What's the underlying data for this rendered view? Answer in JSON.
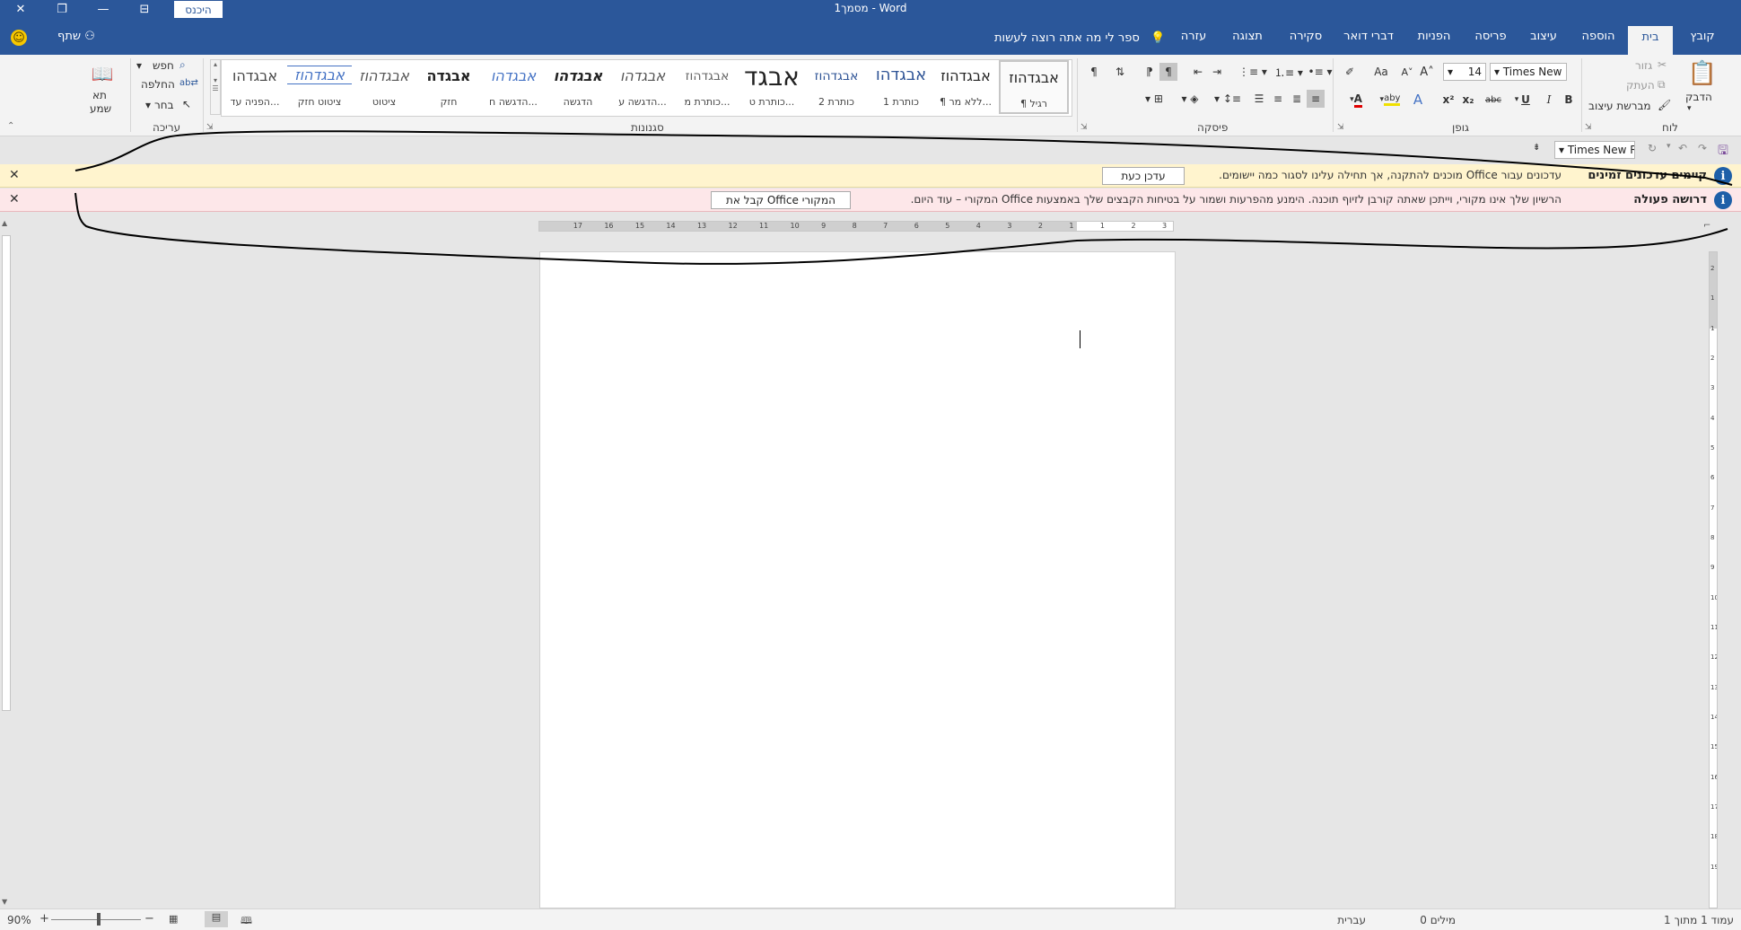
{
  "window": {
    "title": "מסמך1  -  Word",
    "sign_in": "היכנס",
    "controls": [
      "close-icon",
      "restore-icon",
      "minimize-icon",
      "ribbon-display-icon"
    ]
  },
  "tabs": [
    "קובץ",
    "בית",
    "הוספה",
    "עיצוב",
    "פריסה",
    "הפניות",
    "דברי דואר",
    "סקירה",
    "תצוגה",
    "עזרה"
  ],
  "active_tab": "בית",
  "tell_me": "ספר לי מה אתה רוצה לעשות",
  "share": "שתף",
  "ribbon": {
    "clipboard": {
      "label": "לוח",
      "paste": "הדבק",
      "cut": "גזור",
      "copy": "העתק",
      "format_painter": "מברשת עיצוב"
    },
    "font": {
      "label": "גופן",
      "font_name": "Times New R",
      "font_size": "14",
      "grow": "A˄",
      "shrink": "A˅",
      "change_case": "Aa",
      "bold": "B",
      "italic": "I",
      "underline": "U",
      "strike": "abc",
      "subscript": "x₂",
      "superscript": "x²",
      "text_effects": "A",
      "highlight": "aby",
      "font_color": "A",
      "font_color_hex": "#e00000",
      "highlight_hex": "#f0e000"
    },
    "paragraph": {
      "label": "פיסקה",
      "pilcrow": "¶"
    },
    "styles": {
      "label": "סגנונות",
      "items": [
        {
          "sample": "אבגדהוז",
          "name": "¶ רגיל"
        },
        {
          "sample": "אבגדהוז",
          "name": "¶ ללא מר..."
        },
        {
          "sample": "אבגדהו",
          "name": "כותרת 1"
        },
        {
          "sample": "אבגדהוז",
          "name": "כותרת 2"
        },
        {
          "sample": "אבגד",
          "name": "כותרת ט..."
        },
        {
          "sample": "אבגדהוז",
          "name": "כותרת מ..."
        },
        {
          "sample": "אבגדהו",
          "name": "הדגשה ע..."
        },
        {
          "sample": "אבגדהו",
          "name": "הדגשה"
        },
        {
          "sample": "אבגדהו",
          "name": "הדגשה ח..."
        },
        {
          "sample": "אבגדה",
          "name": "חזק"
        },
        {
          "sample": "אבגדהוז",
          "name": "ציטוט"
        },
        {
          "sample": "אבגדהוז",
          "name": "ציטוט חזק"
        },
        {
          "sample": "אבגדהו",
          "name": "הפניה עד..."
        }
      ]
    },
    "editing": {
      "label": "עריכה",
      "find": "חפש",
      "replace": "החלפה",
      "select": "בחר"
    },
    "voice": {
      "label1": "תא",
      "label2": "שמע"
    }
  },
  "qat": {
    "font_name": "Times New R"
  },
  "messages": [
    {
      "title": "קיימים עדכונים זמינים",
      "text": "עדכונים עבור Office מוכנים להתקנה, אך תחילה עלינו לסגור כמה יישומים.",
      "button": "עדכן כעת"
    },
    {
      "title": "דרושה פעולה",
      "text": "הרשיון שלך אינו מקורי, וייתכן שאתה קורבן לזיוף תוכנה. הימנע מהפרעות ושמור על בטיחות הקבצים שלך באמצעות Office המקורי – עוד היום.",
      "button": "קבל את Office המקורי"
    }
  ],
  "ruler": {
    "h_labels": [
      "3",
      "2",
      "1",
      "1",
      "2",
      "3",
      "4",
      "5",
      "6",
      "7",
      "8",
      "9",
      "10",
      "11",
      "12",
      "13",
      "14",
      "15",
      "16",
      "17"
    ],
    "v_labels": [
      "2",
      "1",
      "1",
      "2",
      "3",
      "4",
      "5",
      "6",
      "7",
      "8",
      "9",
      "10",
      "11",
      "12",
      "13",
      "14",
      "15",
      "16",
      "17",
      "18",
      "19"
    ]
  },
  "status": {
    "page": "עמוד 1 מתוך 1",
    "words": "0 מילים",
    "language": "עברית",
    "zoom": "90%",
    "zoom_in": "+",
    "zoom_out": "−"
  }
}
